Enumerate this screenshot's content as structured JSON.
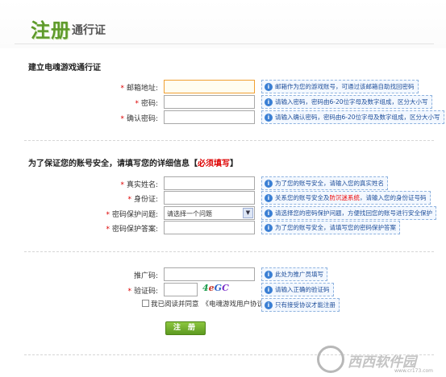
{
  "header": {
    "logo_main": "注册",
    "logo_sub": "通行证"
  },
  "section1": {
    "title": "建立电魂游戏通行证",
    "fields": [
      {
        "label": "邮箱地址:",
        "required": true,
        "tip": "邮箱作为您的游戏账号，可通过该邮箱自助找回密码"
      },
      {
        "label": "密码:",
        "required": true,
        "tip": "请输入密码，密码由6-20位字母及数字组成，区分大小写"
      },
      {
        "label": "确认密码:",
        "required": true,
        "tip": "请输入确认密码，密码由6-20位字母及数字组成，区分大小写"
      }
    ]
  },
  "section2": {
    "title_prefix": "为了保证您的账号安全，请填写您的详细信息【",
    "title_required": "必须填写",
    "title_suffix": "】",
    "fields": [
      {
        "label": "真实姓名:",
        "required": true,
        "tip": "为了您的账号安全，请输入您的真实姓名"
      },
      {
        "label": "身份证:",
        "required": true,
        "tip_pre": "关系您的账号安全及",
        "tip_red": "防沉迷系统",
        "tip_post": "，请输入您的身份证号码"
      },
      {
        "label": "密码保护问题:",
        "required": true,
        "select_value": "请选择一个问题",
        "tip": "请选择您的密码保护问题，方便找回您的账号进行安全保护"
      },
      {
        "label": "密码保护答案:",
        "required": true,
        "tip": "为了您的账号安全，请填写您的密码保护答案"
      }
    ]
  },
  "section3": {
    "fields": [
      {
        "label": "推广码:",
        "required": false,
        "tip": "此处为推广员填写"
      },
      {
        "label": "验证码:",
        "required": true,
        "captcha": "4eGC",
        "tip": "请输入正确的验证码"
      }
    ],
    "agree_text": "我已阅读并同意",
    "agree_link": "《电魂游戏用户协议》",
    "agree_tip": "只有接受协议才能注册",
    "submit": "注 册"
  },
  "watermark": {
    "text": "西西软件园",
    "url": "www.cr173.com"
  },
  "colors": {
    "brand": "#5e9a2a",
    "required": "#dd0000",
    "tip_text": "#1e4e9a",
    "tip_border": "#8fb3df",
    "button": "#6aa82a"
  }
}
